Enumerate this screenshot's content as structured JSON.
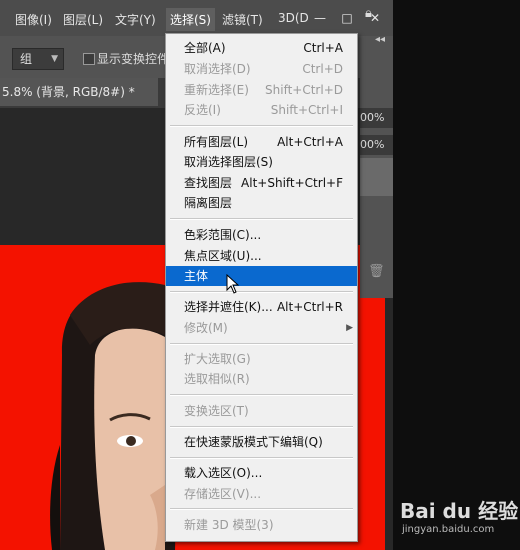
{
  "menubar": {
    "items": [
      "图像(I)",
      "图层(L)",
      "文字(Y)",
      "选择(S)",
      "滤镜(T)",
      "3D(D"
    ],
    "minimize": "—",
    "maximize": "□",
    "close": "✕"
  },
  "options": {
    "group_select": "组",
    "show_transform": "显示变换控件",
    "collapse": "◂◂"
  },
  "tabs": {
    "document": "5.8% (背景, RGB/8#) *",
    "close": "×"
  },
  "panel": {
    "opacity": "00%",
    "fill": "00%"
  },
  "select_menu": {
    "items": [
      {
        "label": "全部(A)",
        "shortcut": "Ctrl+A",
        "enabled": true
      },
      {
        "label": "取消选择(D)",
        "shortcut": "Ctrl+D",
        "enabled": false
      },
      {
        "label": "重新选择(E)",
        "shortcut": "Shift+Ctrl+D",
        "enabled": false
      },
      {
        "label": "反选(I)",
        "shortcut": "Shift+Ctrl+I",
        "enabled": false
      },
      {
        "label": "所有图层(L)",
        "shortcut": "Alt+Ctrl+A",
        "enabled": true
      },
      {
        "label": "取消选择图层(S)",
        "shortcut": "",
        "enabled": true
      },
      {
        "label": "查找图层",
        "shortcut": "Alt+Shift+Ctrl+F",
        "enabled": true
      },
      {
        "label": "隔离图层",
        "shortcut": "",
        "enabled": true
      },
      {
        "label": "色彩范围(C)...",
        "shortcut": "",
        "enabled": true
      },
      {
        "label": "焦点区域(U)...",
        "shortcut": "",
        "enabled": true
      },
      {
        "label": "主体",
        "shortcut": "",
        "enabled": true,
        "highlighted": true
      },
      {
        "label": "选择并遮住(K)...",
        "shortcut": "Alt+Ctrl+R",
        "enabled": true
      },
      {
        "label": "修改(M)",
        "shortcut": "",
        "enabled": false,
        "submenu": true
      },
      {
        "label": "扩大选取(G)",
        "shortcut": "",
        "enabled": false
      },
      {
        "label": "选取相似(R)",
        "shortcut": "",
        "enabled": false
      },
      {
        "label": "变换选区(T)",
        "shortcut": "",
        "enabled": false
      },
      {
        "label": "在快速蒙版模式下编辑(Q)",
        "shortcut": "",
        "enabled": true
      },
      {
        "label": "载入选区(O)...",
        "shortcut": "",
        "enabled": true
      },
      {
        "label": "存储选区(V)...",
        "shortcut": "",
        "enabled": false
      },
      {
        "label": "新建 3D 模型(3)",
        "shortcut": "",
        "enabled": false
      }
    ]
  },
  "watermark": {
    "logo": "Bai du 经验",
    "url": "jingyan.baidu.com"
  },
  "colors": {
    "highlight": "#0a69cf",
    "canvas_red": "#f41200"
  }
}
